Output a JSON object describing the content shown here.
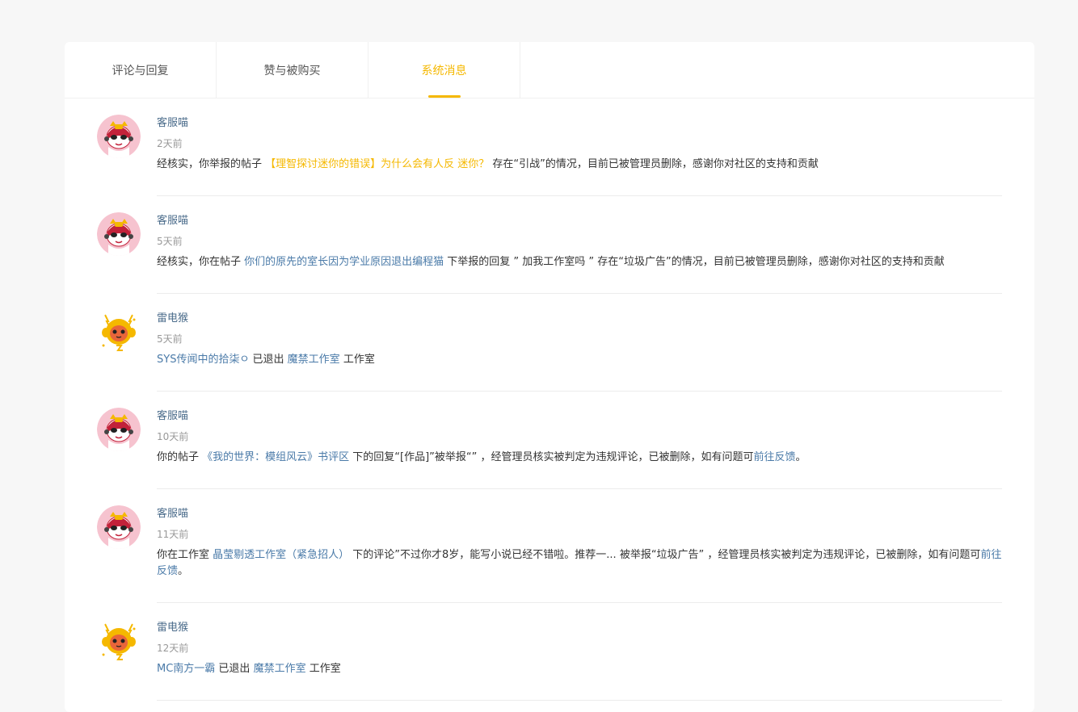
{
  "tabs": [
    {
      "label": "评论与回复"
    },
    {
      "label": "赞与被购买"
    },
    {
      "label": "系统消息"
    }
  ],
  "accent_color": "#f5b800",
  "link_color": "#4a7aa8",
  "messages": [
    {
      "avatar_icon": "cat-avatar-icon",
      "sender": "客服喵",
      "time": "2天前",
      "parts": [
        {
          "t": "经核实，你举报的帖子 "
        },
        {
          "t": "【理智探讨迷你的错误】为什么会有人反 迷你？",
          "link": "yellow"
        },
        {
          "t": " 存在“引战”的情况，目前已被管理员删除，感谢你对社区的支持和贡献"
        }
      ]
    },
    {
      "avatar_icon": "cat-avatar-icon",
      "sender": "客服喵",
      "time": "5天前",
      "parts": [
        {
          "t": "经核实，你在帖子 "
        },
        {
          "t": "你们的原先的室长因为学业原因退出编程猫",
          "link": "blue"
        },
        {
          "t": " 下举报的回复 ” 加我工作室吗 ” 存在“垃圾广告”的情况，目前已被管理员删除，感谢你对社区的支持和贡献"
        }
      ]
    },
    {
      "avatar_icon": "thunder-monkey-avatar-icon",
      "sender": "雷电猴",
      "time": "5天前",
      "parts": [
        {
          "t": " "
        },
        {
          "t": "SYS传闻中的拾柒ㅇ",
          "link": "blue"
        },
        {
          "t": " 已退出 "
        },
        {
          "t": "魔禁工作室",
          "link": "blue"
        },
        {
          "t": " 工作室"
        }
      ]
    },
    {
      "avatar_icon": "cat-avatar-icon",
      "sender": "客服喵",
      "time": "10天前",
      "parts": [
        {
          "t": "你的帖子 "
        },
        {
          "t": "《我的世界：模组风云》书评区",
          "link": "blue"
        },
        {
          "t": " 下的回复“[作品]”被举报“” ，经管理员核实被判定为违规评论，已被删除，如有问题可"
        },
        {
          "t": "前往反馈",
          "link": "blue"
        },
        {
          "t": "。"
        }
      ]
    },
    {
      "avatar_icon": "cat-avatar-icon",
      "sender": "客服喵",
      "time": "11天前",
      "parts": [
        {
          "t": "你在工作室 "
        },
        {
          "t": "晶莹剔透工作室（紧急招人）",
          "link": "blue"
        },
        {
          "t": " 下的评论”不过你才8岁，能写小说已经不错啦。推荐一... 被举报“垃圾广告” ，经管理员核实被判定为违规评论，已被删除，如有问题可"
        },
        {
          "t": "前往反馈",
          "link": "blue"
        },
        {
          "t": "。"
        }
      ]
    },
    {
      "avatar_icon": "thunder-monkey-avatar-icon",
      "sender": "雷电猴",
      "time": "12天前",
      "parts": [
        {
          "t": " "
        },
        {
          "t": "MC南方一霸",
          "link": "blue"
        },
        {
          "t": " 已退出 "
        },
        {
          "t": "魔禁工作室",
          "link": "blue"
        },
        {
          "t": " 工作室"
        }
      ]
    }
  ]
}
